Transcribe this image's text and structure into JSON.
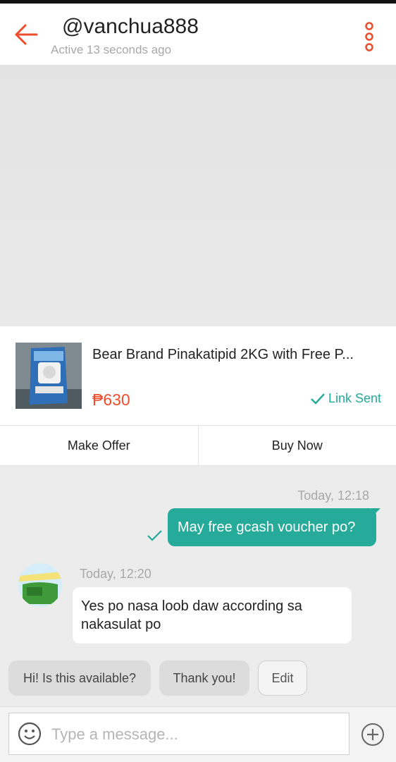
{
  "header": {
    "username": "@vanchua888",
    "status": "Active 13 seconds ago"
  },
  "product": {
    "title": "Bear Brand  Pinakatipid 2KG with Free P...",
    "price": "₱630",
    "link_status": "Link Sent"
  },
  "actions": {
    "make_offer": "Make Offer",
    "buy_now": "Buy Now"
  },
  "messages": [
    {
      "direction": "outgoing",
      "time": "Today, 12:18",
      "text": "May free gcash voucher po?"
    },
    {
      "direction": "incoming",
      "time": "Today, 12:20",
      "text": "Yes po nasa loob daw according sa nakasulat po"
    }
  ],
  "quick_replies": [
    "Hi! Is this available?",
    "Thank you!",
    "Edit"
  ],
  "composer": {
    "placeholder": "Type a message..."
  },
  "colors": {
    "accent": "#ee4d2d",
    "teal": "#26aa99"
  },
  "icons": {
    "back": "back-arrow-icon",
    "more": "more-vertical-icon",
    "check": "check-icon",
    "emoji": "emoji-icon",
    "plus": "plus-icon"
  }
}
